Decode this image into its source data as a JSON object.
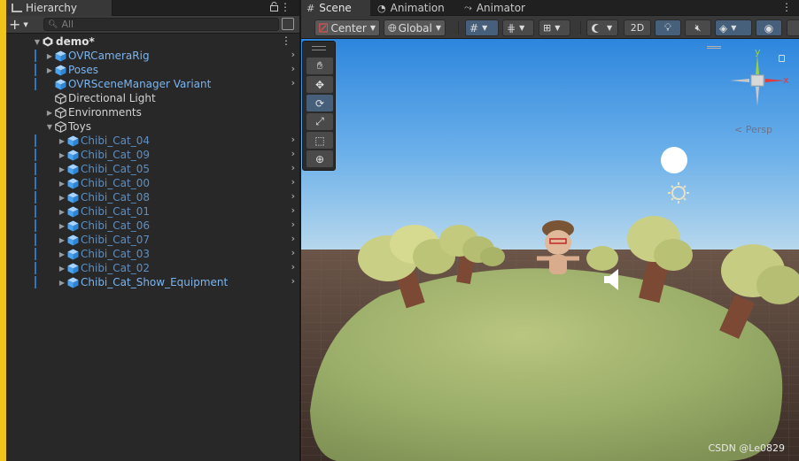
{
  "hierarchy": {
    "tab_title": "Hierarchy",
    "menu_glyph": "⋮",
    "add_glyph": "+",
    "search": {
      "placeholder": "All"
    },
    "scene": {
      "name": "demo*"
    },
    "items": [
      {
        "label": "OVRCameraRig",
        "prefab": true,
        "expandable": true,
        "has_child_arrow": true,
        "indent": 1,
        "icon": "prefab-cube-icon"
      },
      {
        "label": "Poses",
        "prefab": true,
        "expandable": true,
        "has_child_arrow": true,
        "indent": 1,
        "icon": "prefab-cube-icon"
      },
      {
        "label": "OVRSceneManager Variant",
        "prefab": true,
        "expandable": false,
        "has_child_arrow": true,
        "indent": 1,
        "icon": "prefab-variant-cube-icon"
      },
      {
        "label": "Directional Light",
        "prefab": false,
        "expandable": false,
        "has_child_arrow": false,
        "indent": 1,
        "icon": "gameobject-cube-icon"
      },
      {
        "label": "Environments",
        "prefab": false,
        "expandable": true,
        "has_child_arrow": false,
        "indent": 1,
        "icon": "gameobject-cube-icon"
      },
      {
        "label": "Toys",
        "prefab": false,
        "expandable": true,
        "expanded": true,
        "has_child_arrow": false,
        "indent": 1,
        "icon": "gameobject-cube-icon"
      },
      {
        "label": "Chibi_Cat_04",
        "prefab": true,
        "expandable": true,
        "has_child_arrow": true,
        "indent": 2,
        "icon": "prefab-cube-icon"
      },
      {
        "label": "Chibi_Cat_09",
        "prefab": true,
        "expandable": true,
        "has_child_arrow": true,
        "indent": 2,
        "icon": "prefab-cube-icon"
      },
      {
        "label": "Chibi_Cat_05",
        "prefab": true,
        "expandable": true,
        "has_child_arrow": true,
        "indent": 2,
        "icon": "prefab-cube-icon"
      },
      {
        "label": "Chibi_Cat_00",
        "prefab": true,
        "expandable": true,
        "has_child_arrow": true,
        "indent": 2,
        "icon": "prefab-cube-icon"
      },
      {
        "label": "Chibi_Cat_08",
        "prefab": true,
        "expandable": true,
        "has_child_arrow": true,
        "indent": 2,
        "icon": "prefab-cube-icon"
      },
      {
        "label": "Chibi_Cat_01",
        "prefab": true,
        "expandable": true,
        "has_child_arrow": true,
        "indent": 2,
        "icon": "prefab-cube-icon"
      },
      {
        "label": "Chibi_Cat_06",
        "prefab": true,
        "expandable": true,
        "has_child_arrow": true,
        "indent": 2,
        "icon": "prefab-cube-icon"
      },
      {
        "label": "Chibi_Cat_07",
        "prefab": true,
        "expandable": true,
        "has_child_arrow": true,
        "indent": 2,
        "icon": "prefab-cube-icon"
      },
      {
        "label": "Chibi_Cat_03",
        "prefab": true,
        "expandable": true,
        "has_child_arrow": true,
        "indent": 2,
        "icon": "prefab-cube-icon"
      },
      {
        "label": "Chibi_Cat_02",
        "prefab": true,
        "expandable": true,
        "has_child_arrow": true,
        "indent": 2,
        "icon": "prefab-cube-icon"
      },
      {
        "label": "Chibi_Cat_Show_Equipment",
        "prefab": true,
        "expandable": true,
        "has_child_arrow": true,
        "indent": 2,
        "icon": "prefab-cube-icon",
        "bright": true
      }
    ]
  },
  "scene_view": {
    "tabs": [
      {
        "label": "Scene",
        "icon": "#",
        "active": true
      },
      {
        "label": "Animation",
        "icon": "◔",
        "active": false
      },
      {
        "label": "Animator",
        "icon": "⤳",
        "active": false
      }
    ],
    "menu_glyph": "⋮",
    "toolbar": {
      "pivot_mode": "Center",
      "pivot_rotation": "Global",
      "mode_2d": "2D"
    },
    "gizmo": {
      "axis_y": "y",
      "axis_x": "x",
      "projection": "Persp"
    },
    "colors": {
      "prefab_text": "#7ab4ef",
      "selected_tool": "#46607c",
      "axis_x": "#e03c3c",
      "axis_y": "#9ad23c",
      "axis_z": "#3c78e0"
    }
  },
  "watermark": "CSDN @Le0829"
}
